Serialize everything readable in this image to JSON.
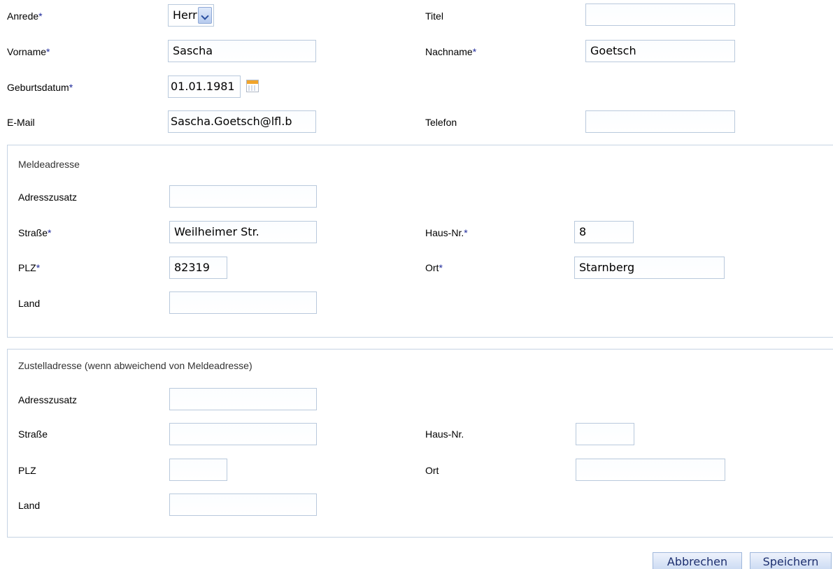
{
  "required_marker": "*",
  "personal": {
    "anrede": {
      "label": "Anrede",
      "value": "Herr"
    },
    "titel": {
      "label": "Titel",
      "value": ""
    },
    "vorname": {
      "label": "Vorname",
      "value": "Sascha"
    },
    "nachname": {
      "label": "Nachname",
      "value": "Goetsch"
    },
    "geburtsdatum": {
      "label": "Geburtsdatum",
      "value": "01.01.1981"
    },
    "email": {
      "label": "E-Mail",
      "value": "Sascha.Goetsch@lfl.b"
    },
    "telefon": {
      "label": "Telefon",
      "value": ""
    }
  },
  "meldeadresse": {
    "legend": "Meldeadresse",
    "adresszusatz": {
      "label": "Adresszusatz",
      "value": ""
    },
    "strasse": {
      "label": "Straße",
      "value": "Weilheimer Str."
    },
    "hausnr": {
      "label": "Haus-Nr.",
      "value": "8"
    },
    "plz": {
      "label": "PLZ",
      "value": "82319"
    },
    "ort": {
      "label": "Ort",
      "value": "Starnberg"
    },
    "land": {
      "label": "Land",
      "value": ""
    }
  },
  "zustelladresse": {
    "legend": "Zustelladresse (wenn abweichend von Meldeadresse)",
    "adresszusatz": {
      "label": "Adresszusatz",
      "value": ""
    },
    "strasse": {
      "label": "Straße",
      "value": ""
    },
    "hausnr": {
      "label": "Haus-Nr.",
      "value": ""
    },
    "plz": {
      "label": "PLZ",
      "value": ""
    },
    "ort": {
      "label": "Ort",
      "value": ""
    },
    "land": {
      "label": "Land",
      "value": ""
    }
  },
  "buttons": {
    "cancel": "Abbrechen",
    "save": "Speichern"
  },
  "icons": {
    "dropdown": "chevron-down-icon",
    "calendar": "calendar-icon"
  },
  "colors": {
    "required_asterisk": "#1f2a9a",
    "field_border": "#b9c9dc",
    "button_text": "#1c2e6e"
  }
}
